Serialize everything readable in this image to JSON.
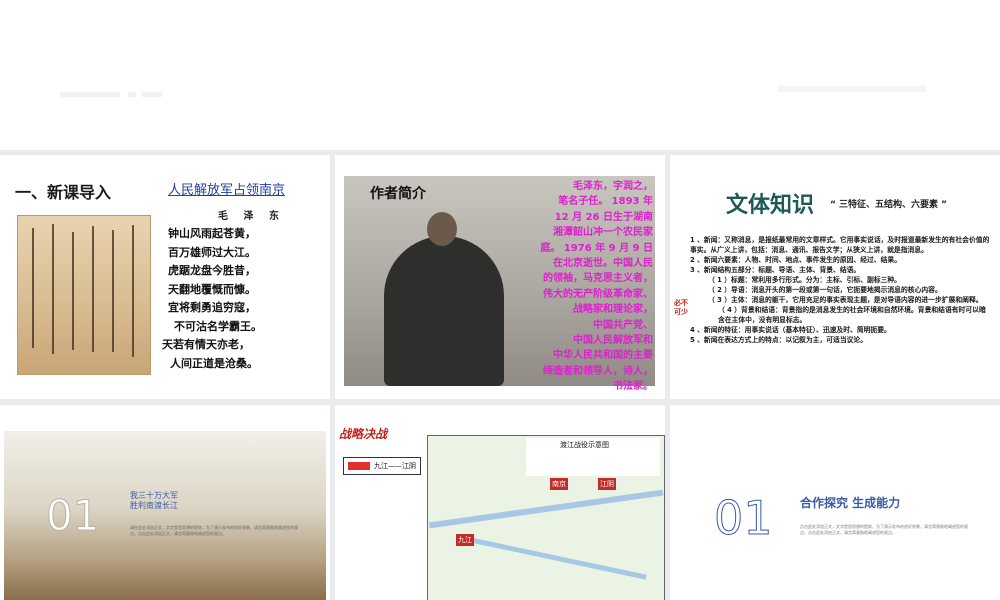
{
  "slide1": {
    "title": "一、新课导入",
    "subtitle": "人民解放军占领南京",
    "author": "毛 泽 东",
    "poem_lines": [
      "钟山风雨起苍黄，",
      "百万雄师过大江。",
      "虎踞龙盘今胜昔，",
      "天翻地覆慨而慷。",
      "宜将剩勇追穷寇，",
      "不可沽名学霸王。",
      "天若有情天亦老，",
      "人间正道是沧桑。"
    ]
  },
  "slide2": {
    "heading": "作者简介",
    "bio_lines": [
      "毛泽东，字润之，",
      "笔名子任。 1893 年",
      "12 月 26 日生于湖南",
      "湘潭韶山冲一个农民家",
      "庭。 1976 年 9 月 9 日",
      "在北京逝世。中国人民",
      "的领袖，马克思主义者，",
      "伟大的无产阶级革命家、",
      "战略家和理论家，",
      "中国共产党、",
      "中国人民解放军和",
      "中华人民共和国的主要",
      "缔造者和领导人，诗人，",
      "书法家。"
    ]
  },
  "slide3": {
    "title": "文体知识",
    "subtitle": "“ 三特征、五结构、六要素 ”",
    "note": "必不可少",
    "lines": [
      {
        "text": "1 、新闻：又称消息，是报纸最常用的文章样式。它用事实说话，及时报道最新发生的有社会价值的事实。从广义上讲，包括：消息、通讯、报告文学；从狭义上讲，就是指消息。",
        "level": 0
      },
      {
        "text": "2 、新闻六要素：人物、时间、地点、事件发生的原因、经过、结果。",
        "level": 0
      },
      {
        "text": "3 、新闻结构五部分：标题、导语、主体、背景、结语。",
        "level": 0
      },
      {
        "text": "（ 1 ）标题：常利用多行形式。分为：主标、引标、副标三种。",
        "level": 1
      },
      {
        "text": "（ 2 ）导语：消息开头的第一段或第一句话，它扼要地揭示消息的核心内容。",
        "level": 1
      },
      {
        "text": "（ 3 ）主体：消息的躯干，它用充足的事实表现主题，是对导语内容的进一步扩展和阐释。",
        "level": 1
      },
      {
        "text": "（ 4 ）背景和结语：背景指的是消息发生的社会环境和自然环境。背景和结语有时可以暗含在主体中，没有明显标志。",
        "level": 2
      },
      {
        "text": "4 、新闻的特征：用事实说话（基本特征）、迅速及时、简明扼要。",
        "level": 0
      },
      {
        "text": "5 、新闻在表达方式上的特点：以记叙为主，可适当议论。",
        "level": 0
      }
    ]
  },
  "slide4": {
    "number": "01",
    "caption_lines": [
      "我三十万大军",
      "胜利南渡长江"
    ],
    "body": "请在此处添加正文，文字是您思想的提炼，为了演示发布的良好效果，请言简意赅地阐述您的观点。点击此处添加正文，请言简意赅地阐述您的观点。"
  },
  "slide5": {
    "badge": "战略决战",
    "route_label": "九江——江阴",
    "map_title": "渡江战役示意图",
    "places": [
      "九江",
      "南京",
      "江阴"
    ]
  },
  "slide6": {
    "number": "01",
    "caption": "合作探究  生成能力",
    "body": "点击此处添加正文，文字是您思想的提炼，为了演示发布的良好效果，请言简意赅地阐述您的观点。点击此处添加正文，请言简意赅地阐述您的观点。"
  }
}
